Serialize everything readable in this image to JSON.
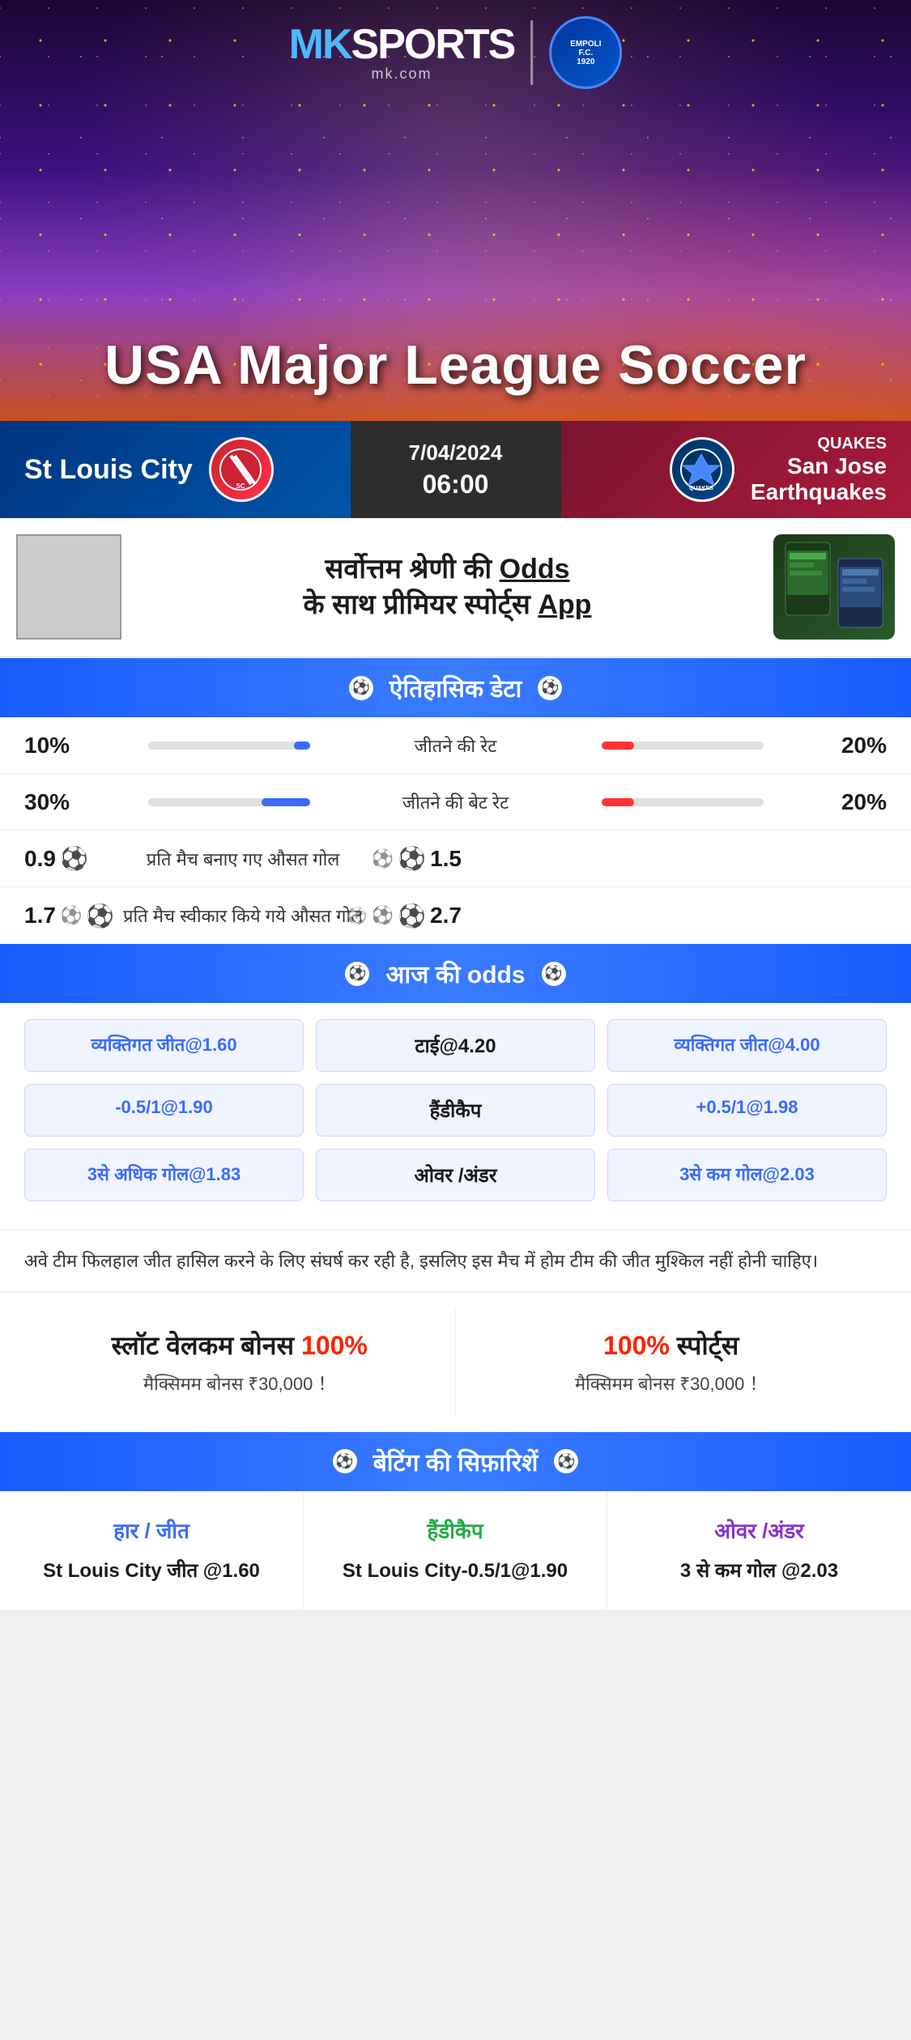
{
  "brand": {
    "mk_prefix": "MK",
    "sports_label": "SPORTS",
    "url_label": "mk.com",
    "empoli_label": "EMPOLI F.C.\n1920"
  },
  "hero": {
    "title": "USA Major League Soccer"
  },
  "match": {
    "home_team": "St Louis City",
    "away_team": "San Jose Earthquakes",
    "away_team_short": "QUAKES",
    "date": "7/04/2024",
    "time": "06:00"
  },
  "ad": {
    "title_line1": "सर्वोत्तम श्रेणी की",
    "title_highlight": "Odds",
    "title_line2": "के साथ प्रीमियर स्पोर्ट्स",
    "title_app": "App"
  },
  "historical_section": {
    "title": "ऐतिहासिक डेटा",
    "rows": [
      {
        "label": "जीतने की रेट",
        "home_value": "10%",
        "away_value": "20%",
        "home_pct": 10,
        "away_pct": 20
      },
      {
        "label": "जीतने की बेट रेट",
        "home_value": "30%",
        "away_value": "20%",
        "home_pct": 30,
        "away_pct": 20
      },
      {
        "label": "प्रति मैच बनाए गए औसत गोल",
        "home_value": "0.9",
        "away_value": "1.5",
        "home_balls": 1,
        "away_balls": 2
      },
      {
        "label": "प्रति मैच स्वीकार किये गये औसत गोल",
        "home_value": "1.7",
        "away_value": "2.7",
        "home_balls": 2,
        "away_balls": 3
      }
    ]
  },
  "odds_section": {
    "title": "आज की odds",
    "rows": [
      {
        "home_label": "व्यक्तिगत जीत@1.60",
        "center_label": "टाई@4.20",
        "away_label": "व्यक्तिगत जीत@4.00",
        "type": "win"
      },
      {
        "home_label": "-0.5/1@1.90",
        "center_label": "हैंडीकैप",
        "away_label": "+0.5/1@1.98",
        "type": "handicap"
      },
      {
        "home_label": "3से अधिक गोल@1.83",
        "center_label": "ओवर /अंडर",
        "away_label": "3से कम गोल@2.03",
        "type": "over_under"
      }
    ]
  },
  "notice": {
    "text": "अवे टीम फिलहाल जीत हासिल करने के लिए संघर्ष कर रही है, इसलिए इस मैच में होम टीम की जीत मुश्किल नहीं होनी चाहिए।"
  },
  "bonus": {
    "slot_title": "स्लॉट वेलकम बोनस",
    "slot_pct": "100%",
    "slot_sub": "मैक्सिमम बोनस ₹30,000  ！",
    "sports_title": "100%",
    "sports_label": "स्पोर्ट्स",
    "sports_sub": "मैक्सिमम बोनस  ₹30,000 ！"
  },
  "recommendations_section": {
    "title": "बेटिंग की सिफ़ारिशें",
    "items": [
      {
        "type": "हार / जीत",
        "type_color": "blue",
        "value": "St Louis City जीत @1.60"
      },
      {
        "type": "हैंडीकैप",
        "type_color": "green",
        "value": "St Louis City-0.5/1@1.90"
      },
      {
        "type": "ओवर /अंडर",
        "type_color": "purple",
        "value": "3 से कम गोल @2.03"
      }
    ]
  }
}
